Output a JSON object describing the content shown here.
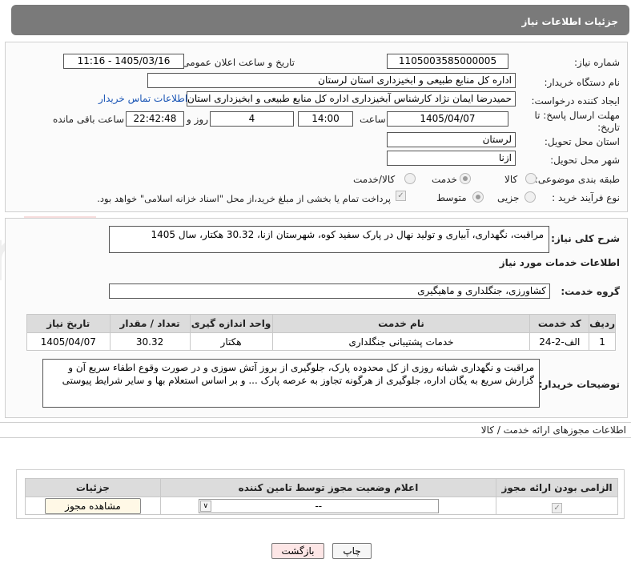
{
  "header": {
    "title": "جزئیات اطلاعات نیاز"
  },
  "form": {
    "need_number_label": "شماره نیاز:",
    "need_number": "1105003585000005",
    "announce_label": "تاریخ و ساعت اعلان عمومی:",
    "announce_value": "1405/03/16 - 11:16",
    "buyer_org_label": "نام دستگاه خریدار:",
    "buyer_org": "اداره کل منابع طبیعی و ابخیزداری استان لرستان",
    "creator_label": "ایجاد کننده درخواست:",
    "creator": "حمیدرضا ایمان نژاد کارشناس آبخیزداری اداره کل منابع طبیعی و ابخیزداری استان لرستان",
    "contact_link": "اطلاعات تماس خریدار",
    "deadline_label_1": "مهلت ارسال پاسخ: تا",
    "deadline_label_2": "تاریخ:",
    "deadline_date": "1405/04/07",
    "time_word": "ساعت",
    "deadline_time": "14:00",
    "days_value": "4",
    "days_word": "روز و",
    "remaining_time": "22:42:48",
    "remaining_word": "ساعت باقی مانده",
    "province_label": "استان محل تحویل:",
    "province": "لرستان",
    "city_label": "شهر محل تحویل:",
    "city": "ازنا",
    "category_label": "طبقه بندی موضوعی:",
    "category_options": [
      "کالا",
      "خدمت",
      "کالا/خدمت"
    ],
    "process_label": "نوع فرآیند خرید :",
    "process_options": [
      "جزیی",
      "متوسط"
    ],
    "payment_note": "پرداخت تمام یا بخشی از مبلغ خرید،از محل \"اسناد خزانه اسلامی\" خواهد بود."
  },
  "need": {
    "summary_label": "شرح کلی نیاز:",
    "summary": "مراقبت، نگهداری، آبیاری و تولید نهال در پارک سفید کوه، شهرستان ازنا، 30.32 هکتار، سال 1405",
    "services_heading": "اطلاعات خدمات مورد نیاز",
    "service_group_label": "گروه خدمت:",
    "service_group": "کشاورزی، جنگلداری و ماهیگیری",
    "table_headers": [
      "ردیف",
      "کد خدمت",
      "نام خدمت",
      "واحد اندازه گیری",
      "تعداد / مقدار",
      "تاریخ نیاز"
    ],
    "rows": [
      {
        "index": "1",
        "code": "الف-2-24",
        "name": "خدمات پشتیبانی جنگلداری",
        "unit": "هکتار",
        "qty": "30.32",
        "date": "1405/04/07"
      }
    ],
    "buyer_notes_label": "توضیحات خریدار:",
    "buyer_notes": "مراقبت و نگهداری شبانه روزی از کل محدوده پارک، جلوگیری از بروز آتش سوزی و در صورت وقوع اطفاء سریع آن و گزارش سریع به یگان اداره، جلوگیری از هرگونه تجاوز به عرصه پارک ...  و بر اساس استعلام بها و سایر شرایط پیوستی"
  },
  "permits": {
    "heading": "اطلاعات مجوزهای ارائه خدمت / کالا",
    "headers": [
      "الزامی بودن ارائه مجوز",
      "اعلام وضعیت مجوز توسط تامین کننده",
      "جزئیات"
    ],
    "status_value": "--",
    "view_button": "مشاهده مجوز"
  },
  "footer": {
    "print_button": "چاپ",
    "back_button": "بازگشت"
  },
  "watermark": {
    "text": "AriaTender.net"
  },
  "colors": {
    "title_bar": "#7a7a7a",
    "table_header": "#dcdcdc",
    "link": "#1a55b5",
    "back_button_bg": "#fde6e6"
  }
}
